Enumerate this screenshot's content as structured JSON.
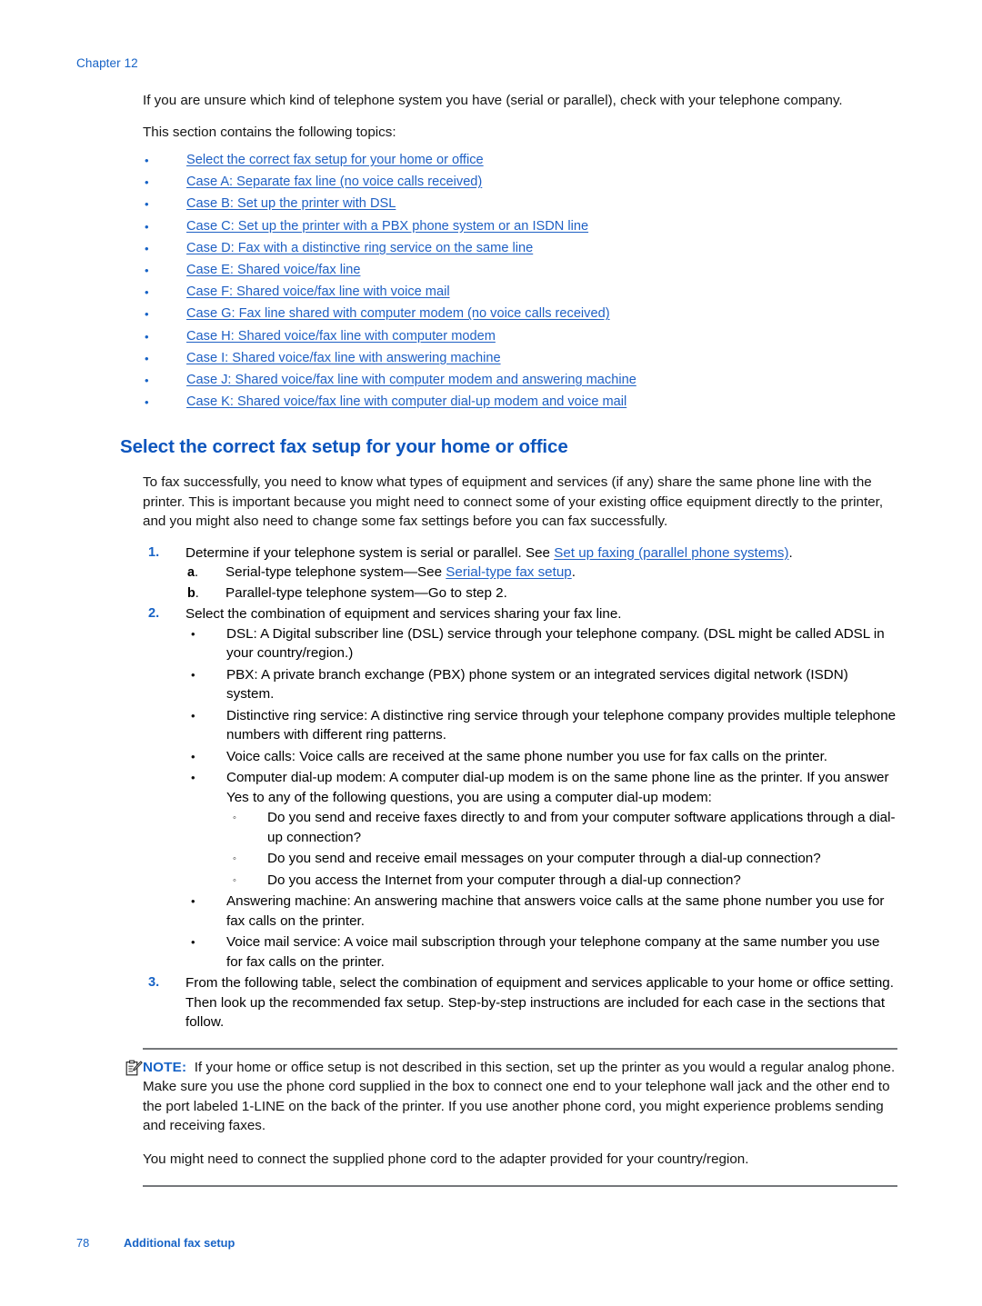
{
  "header": {
    "chapter_label": "Chapter 12"
  },
  "intro": {
    "paragraph1": "If you are unsure which kind of telephone system you have (serial or parallel), check with your telephone company.",
    "paragraph2": "This section contains the following topics:"
  },
  "topics": {
    "bullet_glyph": "•",
    "items": [
      "Select the correct fax setup for your home or office",
      "Case A: Separate fax line (no voice calls received)",
      "Case B: Set up the printer with DSL",
      "Case C: Set up the printer with a PBX phone system or an ISDN line",
      "Case D: Fax with a distinctive ring service on the same line",
      "Case E: Shared voice/fax line",
      "Case F: Shared voice/fax line with voice mail",
      "Case G: Fax line shared with computer modem (no voice calls received)",
      "Case H: Shared voice/fax line with computer modem",
      "Case I: Shared voice/fax line with answering machine",
      "Case J: Shared voice/fax line with computer modem and answering machine",
      "Case K: Shared voice/fax line with computer dial-up modem and voice mail"
    ]
  },
  "section": {
    "heading": "Select the correct fax setup for your home or office",
    "intro": "To fax successfully, you need to know what types of equipment and services (if any) share the same phone line with the printer. This is important because you might need to connect some of your existing office equipment directly to the printer, and you might also need to change some fax settings before you can fax successfully."
  },
  "steps": {
    "step1": {
      "num": "1.",
      "text_before_link": "Determine if your telephone system is serial or parallel. See ",
      "link": "Set up faxing (parallel phone systems)",
      "text_after_link": "."
    },
    "alpha": {
      "a": {
        "mark": "a",
        "mark_dot": ".",
        "text_before_link": "Serial-type telephone system—See ",
        "link": "Serial-type fax setup",
        "text_after_link": "."
      },
      "b": {
        "mark": "b",
        "mark_dot": ".",
        "text": "Parallel-type telephone system—Go to step 2."
      }
    },
    "step2": {
      "num": "2.",
      "text": "Select the combination of equipment and services sharing your fax line.",
      "bullet_glyph": "•",
      "circle_glyph": "◦",
      "items": [
        "DSL: A Digital subscriber line (DSL) service through your telephone company. (DSL might be called ADSL in your country/region.)",
        "PBX: A private branch exchange (PBX) phone system or an integrated services digital network (ISDN) system.",
        "Distinctive ring service: A distinctive ring service through your telephone company provides multiple telephone numbers with different ring patterns.",
        "Voice calls: Voice calls are received at the same phone number you use for fax calls on the printer."
      ],
      "modem_item": "Computer dial-up modem: A computer dial-up modem is on the same phone line as the printer. If you answer Yes to any of the following questions, you are using a computer dial-up modem:",
      "modem_questions": [
        "Do you send and receive faxes directly to and from your computer software applications through a dial-up connection?",
        "Do you send and receive email messages on your computer through a dial-up connection?",
        "Do you access the Internet from your computer through a dial-up connection?"
      ],
      "items_after": [
        "Answering machine: An answering machine that answers voice calls at the same phone number you use for fax calls on the printer.",
        "Voice mail service: A voice mail subscription through your telephone company at the same number you use for fax calls on the printer."
      ]
    },
    "step3": {
      "num": "3.",
      "text": "From the following table, select the combination of equipment and services applicable to your home or office setting. Then look up the recommended fax setup. Step-by-step instructions are included for each case in the sections that follow."
    }
  },
  "note": {
    "label": "NOTE:",
    "text": "If your home or office setup is not described in this section, set up the printer as you would a regular analog phone. Make sure you use the phone cord supplied in the box to connect one end to your telephone wall jack and the other end to the port labeled 1-LINE on the back of the printer. If you use another phone cord, you might experience problems sending and receiving faxes.",
    "paragraph2": "You might need to connect the supplied phone cord to the adapter provided for your country/region."
  },
  "footer": {
    "page_number": "78",
    "title": "Additional fax setup"
  },
  "colors": {
    "link_blue": "#1f60c4",
    "heading_blue": "#0d55bd",
    "accent_blue": "#1763c6",
    "rule_gray": "#75787b",
    "body_text": "#161616"
  }
}
